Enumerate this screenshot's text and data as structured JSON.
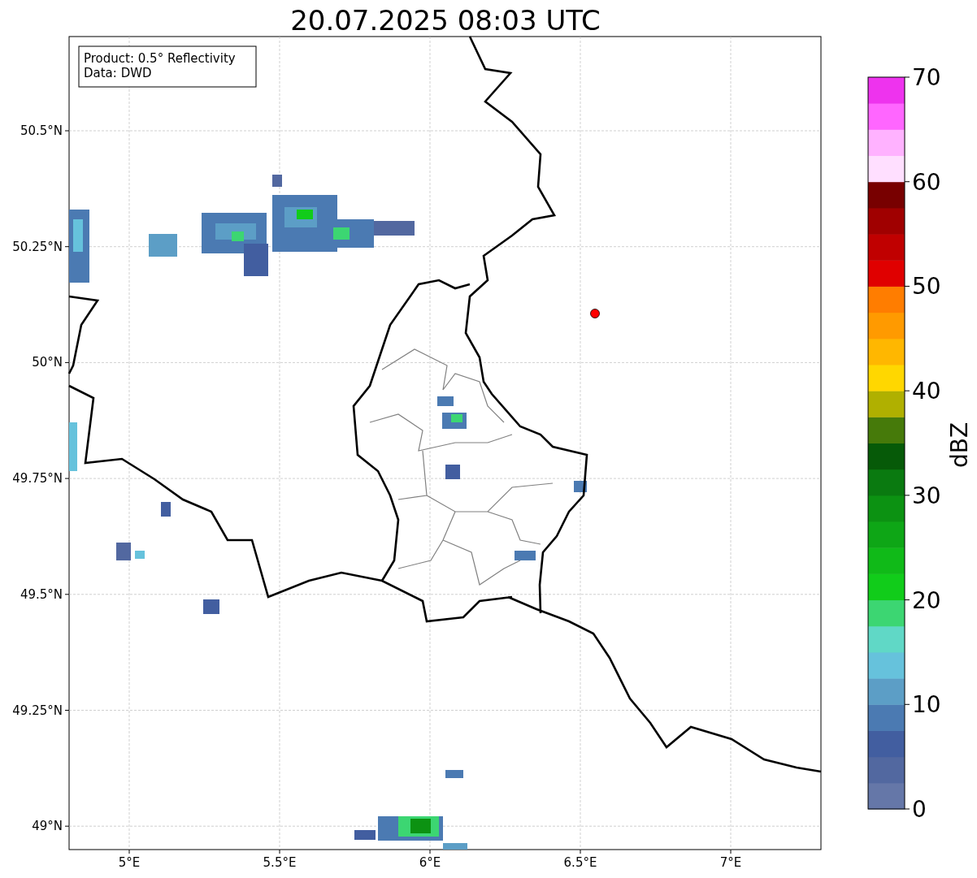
{
  "title": "20.07.2025 08:03 UTC",
  "legend": {
    "lines": [
      "Product: 0.5° Reflectivity",
      "Data: DWD"
    ]
  },
  "lat_ticks": [
    "50.5°N",
    "50.25°N",
    "50°N",
    "49.75°N",
    "49.5°N",
    "49.25°N",
    "49°N"
  ],
  "lon_ticks": [
    "5°E",
    "5.5°E",
    "6°E",
    "6.5°E",
    "7°E"
  ],
  "colorbar": {
    "label": "dBZ",
    "ticks": [
      "70",
      "60",
      "50",
      "40",
      "30",
      "20",
      "10",
      "0"
    ],
    "bands": [
      {
        "color": "#6577a8"
      },
      {
        "color": "#5268a0"
      },
      {
        "color": "#425ea0"
      },
      {
        "color": "#4b7ab2"
      },
      {
        "color": "#5c9ec6"
      },
      {
        "color": "#66c2dc"
      },
      {
        "color": "#60d8c6"
      },
      {
        "color": "#3cd672"
      },
      {
        "color": "#11cc1a"
      },
      {
        "color": "#10ba18"
      },
      {
        "color": "#0ea616"
      },
      {
        "color": "#0c9212"
      },
      {
        "color": "#0a7a10"
      },
      {
        "color": "#065a08"
      },
      {
        "color": "#467a0a"
      },
      {
        "color": "#b0b000"
      },
      {
        "color": "#ffd700"
      },
      {
        "color": "#ffb700"
      },
      {
        "color": "#ff9a00"
      },
      {
        "color": "#ff7d00"
      },
      {
        "color": "#e00000"
      },
      {
        "color": "#c00000"
      },
      {
        "color": "#a00000"
      },
      {
        "color": "#780000"
      },
      {
        "color": "#ffdfff"
      },
      {
        "color": "#ffb2ff"
      },
      {
        "color": "#ff66ff"
      },
      {
        "color": "#ee33ee"
      }
    ]
  }
}
